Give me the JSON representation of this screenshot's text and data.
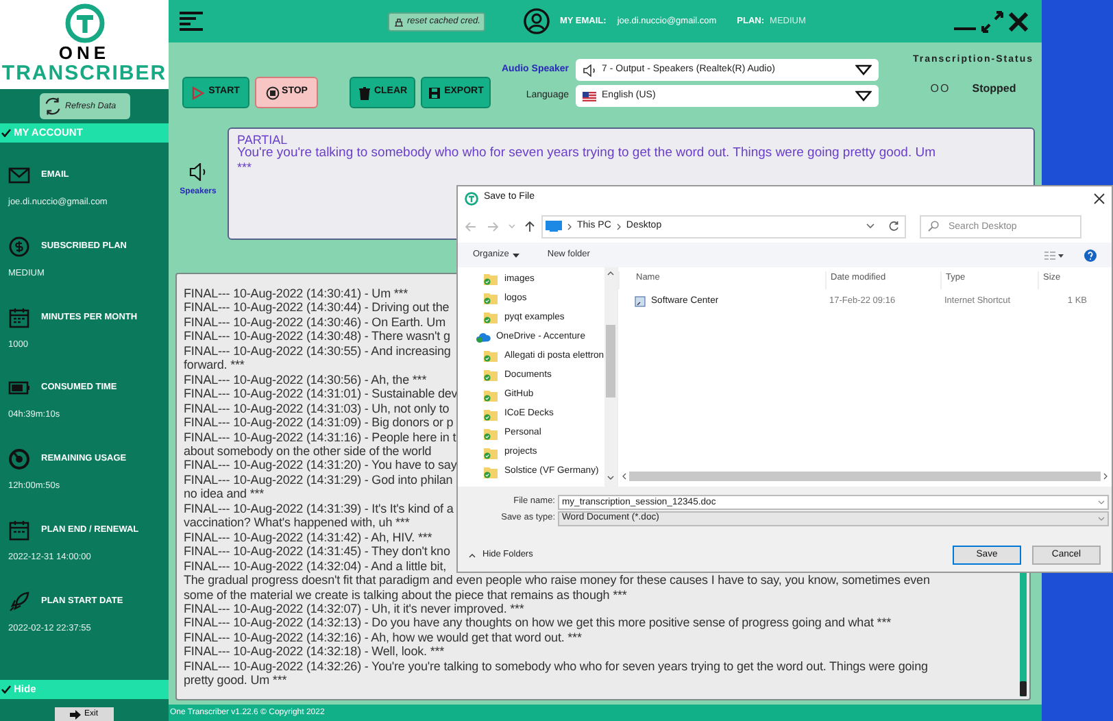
{
  "logo": {
    "top": "ONE",
    "bottom": "TRANSCRIBER"
  },
  "sidebar": {
    "refresh_button": "Refresh Data",
    "section": {
      "label": "MY ACCOUNT",
      "expanded": true
    },
    "items": [
      {
        "label": "EMAIL",
        "value": "joe.di.nuccio@gmail.com"
      },
      {
        "label": "SUBSCRIBED PLAN",
        "value": "MEDIUM"
      },
      {
        "label": "MINUTES PER MONTH",
        "value": "1000"
      },
      {
        "label": "CONSUMED TIME",
        "value": "04h:39m:10s"
      },
      {
        "label": "REMAINING USAGE",
        "value": "12h:00m:50s"
      },
      {
        "label": "PLAN END / RENEWAL",
        "value": "2022-12-31 14:00:00"
      },
      {
        "label": "PLAN START DATE",
        "value": "2022-02-12 22:37:55"
      }
    ],
    "hide": {
      "label": "Hide",
      "expanded": true
    },
    "exit_button": "Exit"
  },
  "header": {
    "reset_button": "reset cached cred.",
    "email_label": "MY EMAIL:",
    "email": "joe.di.nuccio@gmail.com",
    "plan_label": "PLAN:",
    "plan": "MEDIUM"
  },
  "toolbar": {
    "buttons": [
      {
        "label": "START",
        "kind": "start"
      },
      {
        "label": "STOP",
        "kind": "stop"
      },
      {
        "label": "CLEAR",
        "kind": "clear"
      },
      {
        "label": "EXPORT",
        "kind": "export"
      }
    ],
    "audio_label": "Audio Speaker",
    "audio_value": "7 - Output - Speakers (Realtek(R) Audio)",
    "language_label": "Language",
    "language_value": "English (US)",
    "status_title": "Transcription-Status",
    "status_indicator": "OO",
    "status": "Stopped"
  },
  "partial": {
    "speaker_label": "Speakers",
    "heading": "PARTIAL",
    "text": "You're you're talking to somebody who who for seven years trying to get the word out. Things were going pretty good. Um",
    "end_mark": "***"
  },
  "log": [
    "FINAL--- 10-Aug-2022 (14:30:41) - Um ***",
    "FINAL--- 10-Aug-2022 (14:30:44) - Driving out the",
    "FINAL--- 10-Aug-2022 (14:30:46) - On Earth. Um",
    "FINAL--- 10-Aug-2022 (14:30:48) - There wasn't g",
    "FINAL--- 10-Aug-2022 (14:30:55) - And increasing",
    "forward. ***",
    "FINAL--- 10-Aug-2022 (14:30:56) - Ah, the ***",
    "FINAL--- 10-Aug-2022 (14:31:01) - Sustainable dev",
    "FINAL--- 10-Aug-2022 (14:31:03) - Uh, not only to",
    "FINAL--- 10-Aug-2022 (14:31:09) - Big donors or p",
    "FINAL--- 10-Aug-2022 (14:31:16) - People here in t",
    "about somebody on the other side of the world",
    "FINAL--- 10-Aug-2022 (14:31:20) - You have to say",
    "FINAL--- 10-Aug-2022 (14:31:29) - God into philan",
    "no idea and ***",
    "FINAL--- 10-Aug-2022 (14:31:39) - It's It's kind of a",
    "vaccination? What's happened with, uh ***",
    "FINAL--- 10-Aug-2022 (14:31:42) - Ah, HIV. ***",
    "FINAL--- 10-Aug-2022 (14:31:45) - They don't kno",
    "FINAL--- 10-Aug-2022 (14:32:04) - And a little bit,",
    "The gradual progress doesn't fit that paradigm and even people who raise money for these causes I have to say, you know, sometimes even",
    "some of the material we create is talking about the piece that remains as though ***",
    "FINAL--- 10-Aug-2022 (14:32:07) - Uh, it it's never improved. ***",
    "FINAL--- 10-Aug-2022 (14:32:13) - Do you have any thoughts on how we get this more positive sense of progress going and what ***",
    "FINAL--- 10-Aug-2022 (14:32:16) - Ah, how we would get that word out. ***",
    "FINAL--- 10-Aug-2022 (14:32:18) - Well, look. ***",
    "FINAL--- 10-Aug-2022 (14:32:26) - You're you're talking to somebody who who for seven years trying to get the word out. Things were going",
    "pretty good. Um ***"
  ],
  "footer": "One Transcriber v1.22.6 © Copyright 2022",
  "dialog": {
    "title": "Save to File",
    "path": [
      "This PC",
      "Desktop"
    ],
    "search_placeholder": "Search Desktop",
    "organize": "Organize",
    "new_folder": "New folder",
    "tree": [
      {
        "label": "images",
        "kind": "folder"
      },
      {
        "label": "logos",
        "kind": "folder"
      },
      {
        "label": "pyqt examples",
        "kind": "folder"
      },
      {
        "label": "OneDrive - Accenture",
        "kind": "cloud"
      },
      {
        "label": "Allegati di posta elettron",
        "kind": "folder"
      },
      {
        "label": "Documents",
        "kind": "folder"
      },
      {
        "label": "GitHub",
        "kind": "folder"
      },
      {
        "label": "ICoE Decks",
        "kind": "folder"
      },
      {
        "label": "Personal",
        "kind": "folder"
      },
      {
        "label": "projects",
        "kind": "folder"
      },
      {
        "label": "Solstice (VF Germany)",
        "kind": "folder"
      }
    ],
    "columns": [
      "Name",
      "Date modified",
      "Type",
      "Size"
    ],
    "files": [
      {
        "name": "Software Center",
        "date": "17-Feb-22 09:16",
        "type": "Internet Shortcut",
        "size": "1 KB"
      }
    ],
    "file_name_label": "File name:",
    "file_name": "my_transcription_session_12345.doc",
    "save_type_label": "Save as type:",
    "save_type": "Word Document (*.doc)",
    "hide_folders": "Hide Folders",
    "save_button": "Save",
    "cancel_button": "Cancel"
  }
}
